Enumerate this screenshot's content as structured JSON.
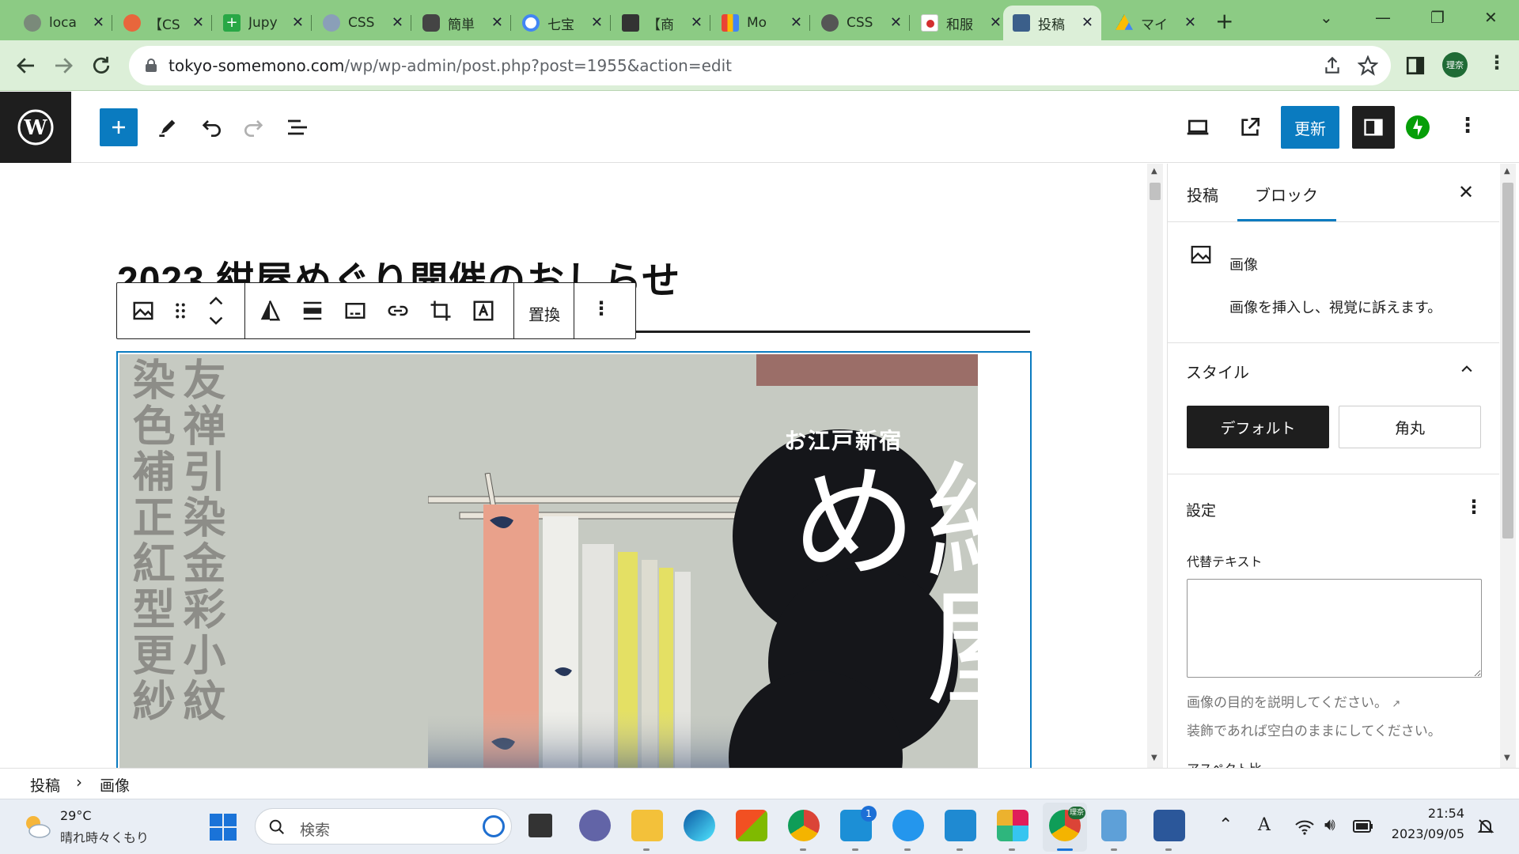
{
  "browser": {
    "tabs": [
      {
        "title": "loca",
        "icon": "globe-icon",
        "color": "#7a8a7a"
      },
      {
        "title": "【CS",
        "icon": "code-icon",
        "color": "#e8663c"
      },
      {
        "title": "Jupy",
        "icon": "plus-icon",
        "color": "#28a745"
      },
      {
        "title": "CSS",
        "icon": "globe-icon",
        "color": "#8a9fb8"
      },
      {
        "title": "簡単",
        "icon": "page-icon",
        "color": "#444444"
      },
      {
        "title": "七宝",
        "icon": "google-icon",
        "color": "#4285f4"
      },
      {
        "title": "【商",
        "icon": "manga-icon",
        "color": "#333333"
      },
      {
        "title": "Mo",
        "icon": "grid-icon",
        "color": "#ea4335"
      },
      {
        "title": "CSS",
        "icon": "avatar-icon",
        "color": "#555555"
      },
      {
        "title": "和服",
        "icon": "flag-icon",
        "color": "#d32f2f"
      },
      {
        "title": "投稿",
        "icon": "site-icon",
        "color": "#3b5f8a"
      },
      {
        "title": "マイ",
        "icon": "drive-icon",
        "color": "#0f9d58"
      }
    ],
    "active_tab": 10,
    "url_domain": "tokyo-somemono.com",
    "url_path": "/wp/wp-admin/post.php?post=1955&action=edit",
    "profile_label": "理奈"
  },
  "editor": {
    "update_label": "更新",
    "post_title": "2023 紺屋めぐり開催のおしらせ",
    "block_toolbar": {
      "replace_label": "置換"
    },
    "poster": {
      "left_col": "友禅引染金彩小紋",
      "right_col": "染色補正紅型更紗",
      "subtitle": "お江戸新宿",
      "main_title": "紺屋め"
    }
  },
  "sidebar": {
    "tab_post": "投稿",
    "tab_block": "ブロック",
    "block_name": "画像",
    "block_description": "画像を挿入し、視覚に訴えます。",
    "styles_heading": "スタイル",
    "style_default": "デフォルト",
    "style_rounded": "角丸",
    "settings_heading": "設定",
    "alt_label": "代替テキスト",
    "alt_value": "",
    "alt_help_line1": "画像の目的を説明してください。",
    "alt_help_line2": "装飾であれば空白のままにしてください。",
    "aspect_label": "アスペクト比"
  },
  "breadcrumb": {
    "items": [
      "投稿",
      "画像"
    ],
    "separator": "›"
  },
  "taskbar": {
    "temperature": "29°C",
    "weather": "晴れ時々くもり",
    "search_placeholder": "検索",
    "time": "21:54",
    "date": "2023/09/05",
    "mail_badge": "1",
    "chrome_profile": "理奈"
  },
  "colors": {
    "wp_blue": "#0a7bc0",
    "chrome_green": "#8ccb84",
    "dark": "#1e1e1e"
  }
}
